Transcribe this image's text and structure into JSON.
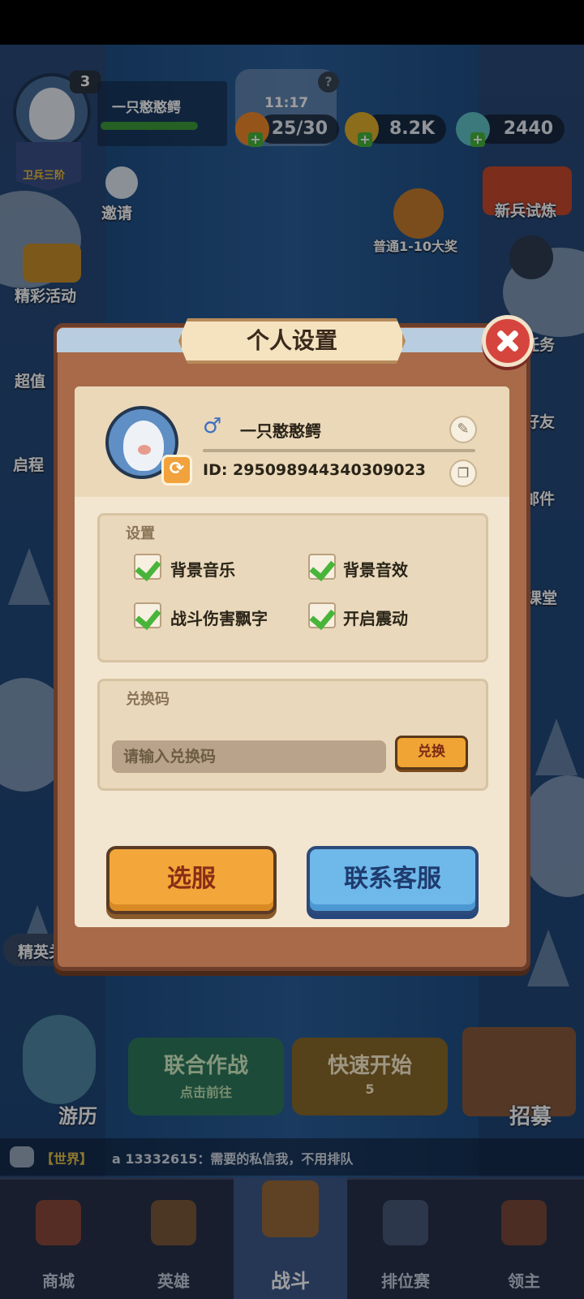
{
  "hud": {
    "level": "3",
    "player_name": "一只憨憨鳄",
    "rank_label": "卫兵三阶",
    "timer": "11:17",
    "help": "?",
    "stamina": "25/30",
    "gold": "8.2K",
    "gems": "2440",
    "plus": "+"
  },
  "side_left": {
    "invite": "邀请",
    "events": "精彩活动",
    "value": "超值",
    "journey": "启程",
    "elite": "精英关卡",
    "travel": "游历"
  },
  "side_right": {
    "trial": "新兵试炼",
    "reward": "普通1-10大奖",
    "tasks": "任务",
    "friends": "好友",
    "mail": "邮件",
    "class": "鹅课堂",
    "recruit": "招募"
  },
  "battle": {
    "coop_title": "联合作战",
    "coop_sub": "点击前往",
    "quick_title": "快速开始",
    "quick_cost": "5"
  },
  "chat": {
    "channel": "【世界】",
    "message": "a 13332615：需要的私信我，不用排队"
  },
  "nav": {
    "items": [
      {
        "label": "商城",
        "icon": "shop-icon"
      },
      {
        "label": "英雄",
        "icon": "hero-card-icon"
      },
      {
        "label": "战斗",
        "icon": "sword-icon"
      },
      {
        "label": "排位赛",
        "icon": "ranked-shield-icon"
      },
      {
        "label": "领主",
        "icon": "lord-banner-icon"
      }
    ]
  },
  "dialog": {
    "title": "个人设置",
    "close": "×",
    "profile": {
      "gender": "♂",
      "name": "一只憨憨鳄",
      "id": "ID: 295098944340309023",
      "edit": "✎",
      "copy": "❐",
      "swap": "⟳"
    },
    "settings": {
      "title": "设置",
      "options": [
        {
          "label": "背景音乐",
          "checked": true
        },
        {
          "label": "背景音效",
          "checked": true
        },
        {
          "label": "战斗伤害飘字",
          "checked": true
        },
        {
          "label": "开启震动",
          "checked": true
        }
      ]
    },
    "redeem": {
      "title": "兑换码",
      "placeholder": "请输入兑换码",
      "button": "兑换"
    },
    "buttons": {
      "select_server": "选服",
      "contact": "联系客服"
    }
  },
  "colors": {
    "accent_orange": "#f3a63a",
    "accent_blue": "#6eb8ea",
    "check_green": "#48b53a",
    "close_red": "#d6453d"
  }
}
